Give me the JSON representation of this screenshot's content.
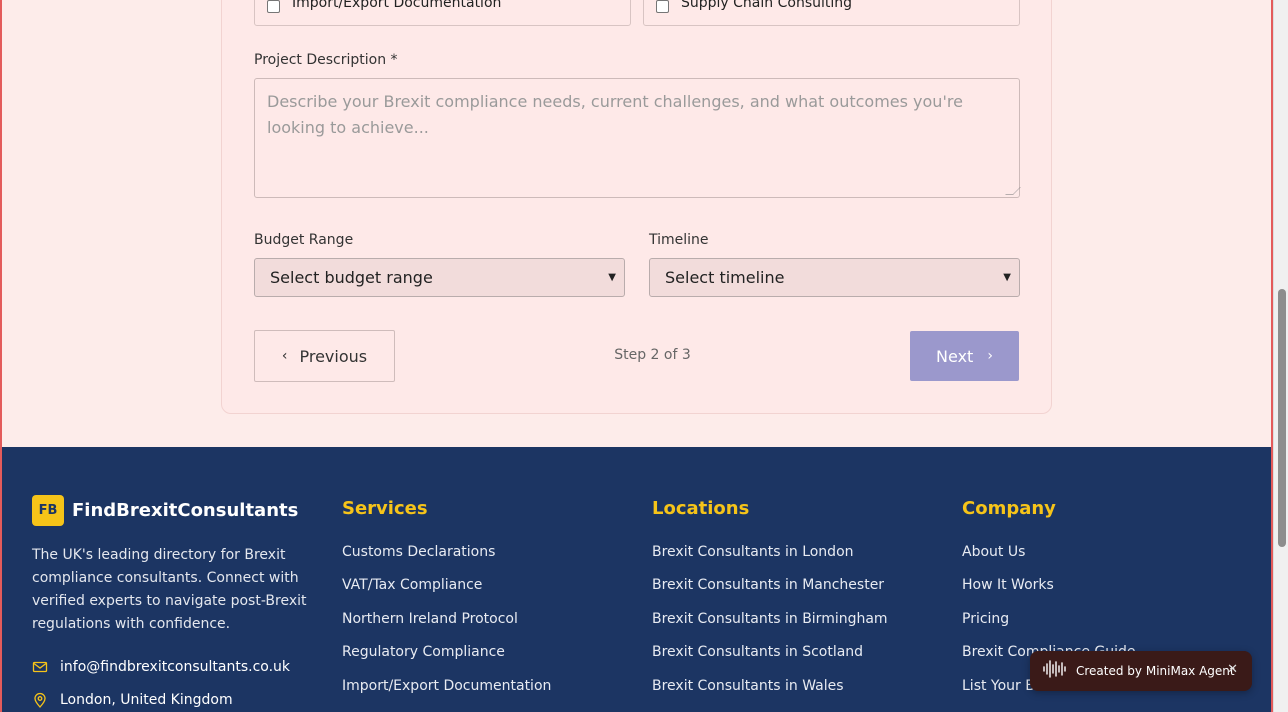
{
  "form": {
    "services_partial": {
      "left_option": "Import/Export Documentation",
      "right_option": "Supply Chain Consulting"
    },
    "description": {
      "label": "Project Description *",
      "placeholder": "Describe your Brexit compliance needs, current challenges, and what outcomes you're looking to achieve..."
    },
    "budget": {
      "label": "Budget Range",
      "selected": "Select budget range"
    },
    "timeline": {
      "label": "Timeline",
      "selected": "Select timeline"
    },
    "nav": {
      "previous_label": "Previous",
      "next_label": "Next",
      "step_text": "Step 2 of 3"
    }
  },
  "footer": {
    "brand": {
      "logo_text": "FB",
      "name": "FindBrexitConsultants",
      "description": "The UK's leading directory for Brexit compliance consultants. Connect with verified experts to navigate post-Brexit regulations with confidence.",
      "email": "info@findbrexitconsultants.co.uk",
      "location": "London, United Kingdom"
    },
    "services": {
      "title": "Services",
      "links": [
        "Customs Declarations",
        "VAT/Tax Compliance",
        "Northern Ireland Protocol",
        "Regulatory Compliance",
        "Import/Export Documentation"
      ]
    },
    "locations": {
      "title": "Locations",
      "links": [
        "Brexit Consultants in London",
        "Brexit Consultants in Manchester",
        "Brexit Consultants in Birmingham",
        "Brexit Consultants in Scotland",
        "Brexit Consultants in Wales"
      ]
    },
    "company": {
      "title": "Company",
      "links": [
        "About Us",
        "How It Works",
        "Pricing",
        "Brexit Compliance Guide",
        "List Your B"
      ]
    }
  },
  "toast": {
    "text": "Created by MiniMax Agent"
  },
  "colors": {
    "accent": "#f6c419",
    "footer_bg": "#1c3563",
    "next_button": "#9b98cc",
    "page_bg": "#fdecea"
  }
}
